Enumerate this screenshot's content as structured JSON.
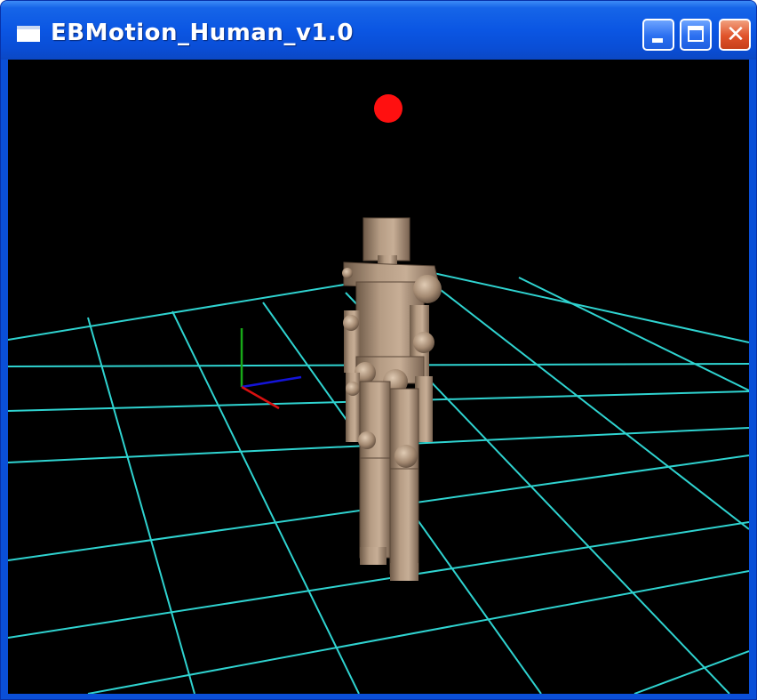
{
  "window": {
    "title": "EBMotion_Human_v1.0",
    "icons": {
      "app": "application-window-icon",
      "minimize": "minimize-icon",
      "maximize": "maximize-icon",
      "close": "close-icon"
    },
    "close_glyph": "✕"
  },
  "scene": {
    "background": "#000000",
    "grid_color": "#2fd3d0",
    "target_marker_color": "#ff1010",
    "figure_color": "#a8907a",
    "axes": {
      "x": "#d81010",
      "y": "#18a818",
      "z": "#1414d8"
    }
  }
}
